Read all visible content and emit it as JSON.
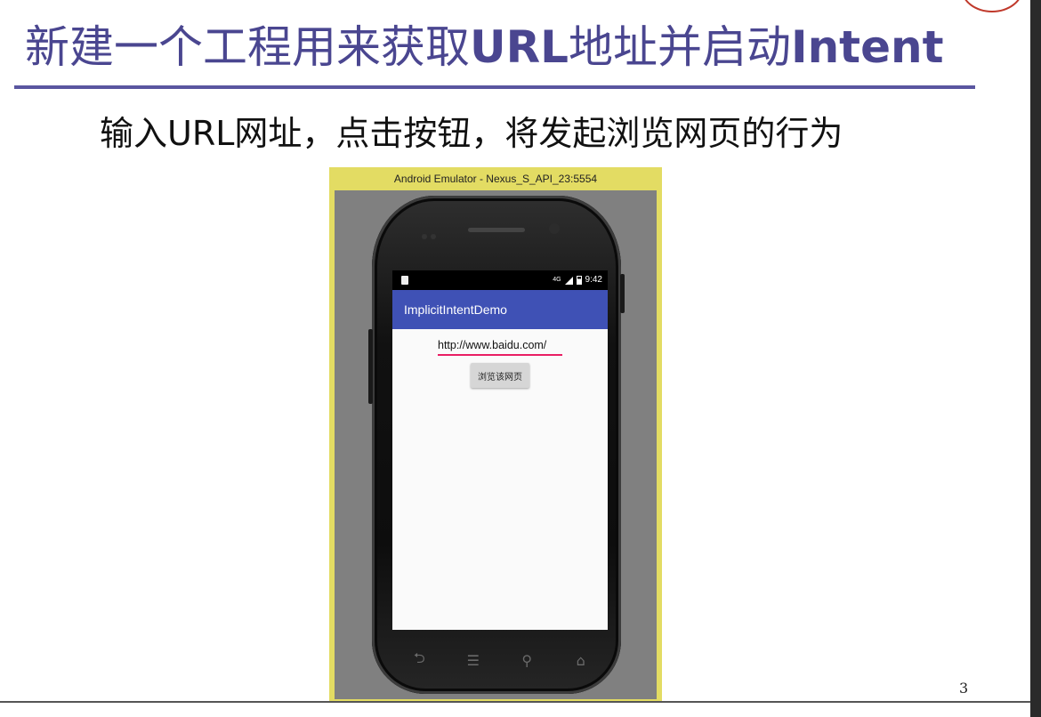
{
  "slide": {
    "title_a": "新建一个工程用来获取",
    "title_b": "URL",
    "title_c": "地址并启动",
    "title_d": "Intent",
    "subtitle": "输入URL网址，点击按钮，将发起浏览网页的行为",
    "page_number": "3"
  },
  "emulator": {
    "window_title": "Android Emulator - Nexus_S_API_23:5554"
  },
  "phone": {
    "status_bar": {
      "time": "9:42",
      "network": "4G"
    },
    "app_bar_title": "ImplicitIntentDemo",
    "url_input_value": "http://www.baidu.com/",
    "browse_button_label": "浏览该网页",
    "nav_keys": {
      "back": "⮌",
      "menu": "☰",
      "search": "⚲",
      "home": "⌂"
    }
  },
  "colors": {
    "title": "#4a4690",
    "emulator_frame": "#e3dc63",
    "app_bar": "#3f51b5",
    "input_underline": "#e91e63"
  }
}
